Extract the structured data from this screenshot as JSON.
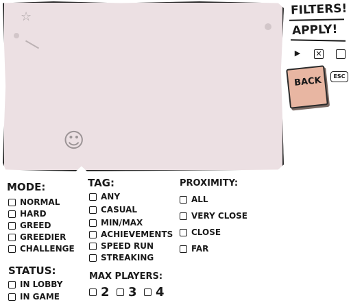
{
  "header": {
    "filters_title": "FILTERS!",
    "apply_label": "APPLY!"
  },
  "back": {
    "label": "BACK",
    "esc": "ESC"
  },
  "mode": {
    "title": "MODE:",
    "options": [
      "NORMAL",
      "HARD",
      "GREED",
      "GREEDIER",
      "CHALLENGE"
    ]
  },
  "tag": {
    "title": "TAG:",
    "options": [
      "ANY",
      "CASUAL",
      "MIN/MAX",
      "ACHIEVEMENTS",
      "SPEED RUN",
      "STREAKING"
    ]
  },
  "proximity": {
    "title": "PROXIMITY:",
    "options": [
      "ALL",
      "VERY CLOSE",
      "CLOSE",
      "FAR"
    ]
  },
  "status": {
    "title": "STATUS:",
    "options": [
      "IN LOBBY",
      "IN GAME"
    ]
  },
  "max_players": {
    "title": "MAX PLAYERS:",
    "options": [
      "2",
      "3",
      "4"
    ]
  },
  "colors": {
    "paper": "#ece0e3",
    "back_card": "#e8b6a2",
    "ink": "#1a1a1a"
  }
}
